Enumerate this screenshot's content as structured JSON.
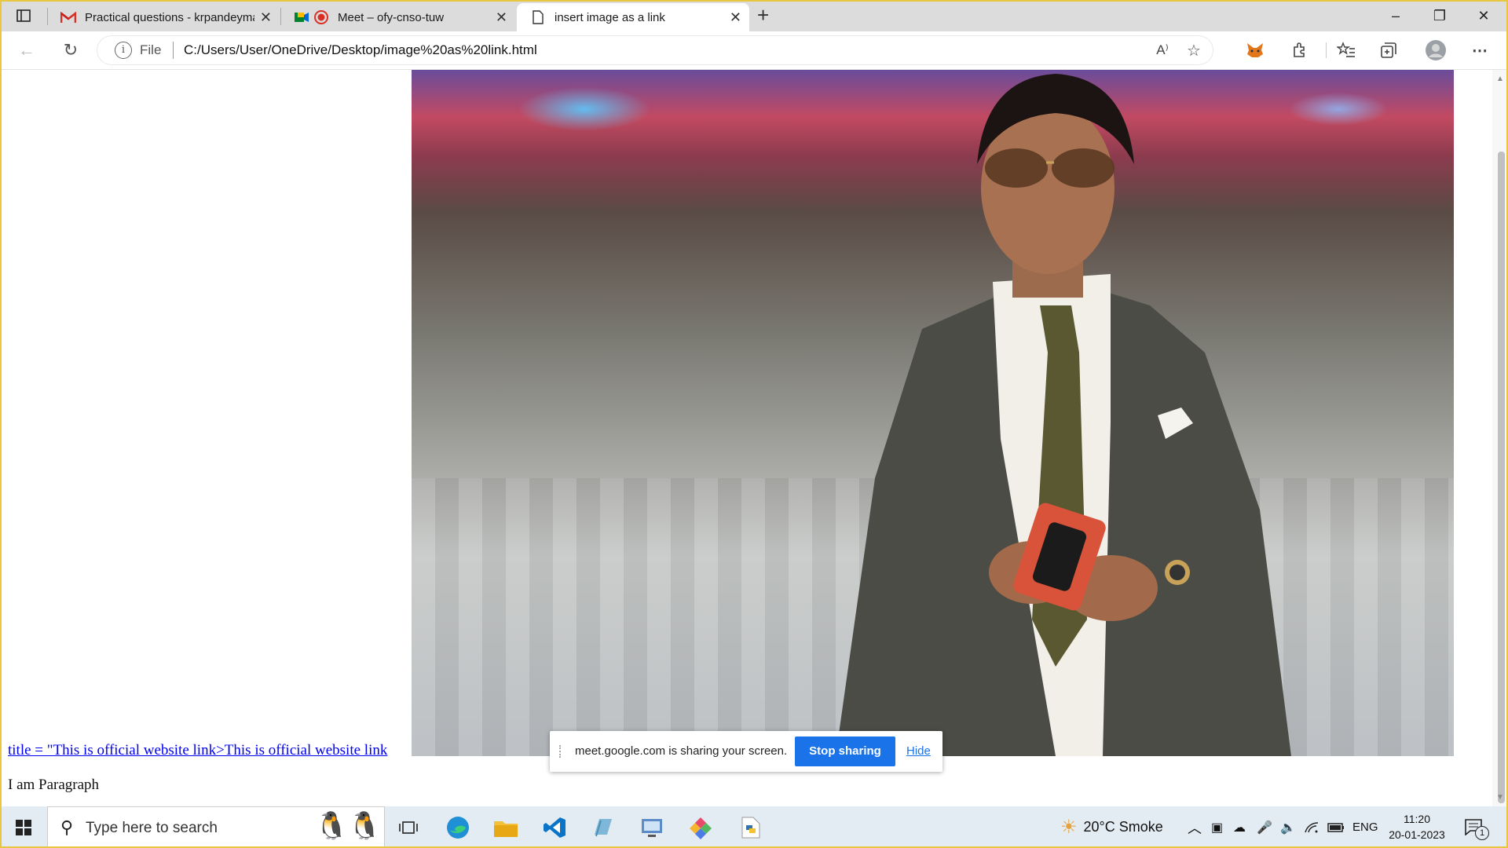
{
  "browser": {
    "tabs": [
      {
        "title": "Practical questions - krpandeyma",
        "icon": "gmail-icon",
        "active": false
      },
      {
        "title": "Meet – ofy-cnso-tuw",
        "icon": "meet-icon",
        "active": false
      },
      {
        "title": "insert image as a link",
        "icon": "page-icon",
        "active": true
      }
    ],
    "new_tab": "+",
    "window": {
      "minimize": "–",
      "restore": "❐",
      "close": "✕"
    }
  },
  "address_bar": {
    "scheme_label": "File",
    "url": "C:/Users/User/OneDrive/Desktop/image%20as%20link.html",
    "read_aloud": "A⁾"
  },
  "page": {
    "link_text": "title = \"This is official website link>This is official website link ",
    "paragraph": "I am Paragraph"
  },
  "share_bar": {
    "message": "meet.google.com is sharing your screen.",
    "stop_label": "Stop sharing",
    "hide_label": "Hide"
  },
  "taskbar": {
    "search_placeholder": "Type here to search",
    "weather": "20°C  Smoke",
    "language": "ENG",
    "time": "11:20",
    "date": "20-01-2023",
    "notification_count": "1"
  },
  "colors": {
    "accent": "#1a73e8",
    "link": "#0000ee",
    "window_border": "#e8c640",
    "taskbar": "#e4ecf3"
  }
}
